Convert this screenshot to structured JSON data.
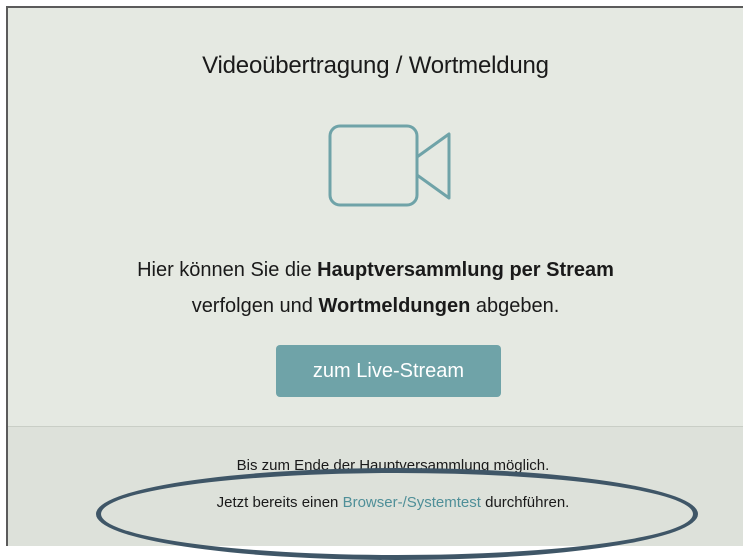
{
  "panel": {
    "title": "Videoübertragung / Wortmeldung",
    "icon": "video-camera-icon",
    "description": {
      "part1": "Hier können Sie die ",
      "bold1": "Hauptversammlung per Stream",
      "part2": "verfolgen und ",
      "bold2": "Wortmeldungen",
      "part3": " abgeben."
    },
    "button_label": "zum Live-Stream"
  },
  "footer": {
    "line1": "Bis zum Ende der Hauptversammlung möglich.",
    "line2_prefix": "Jetzt bereits einen ",
    "line2_link": "Browser-/Systemtest",
    "line2_suffix": " durchführen."
  },
  "colors": {
    "accent": "#6fa3a8",
    "link": "#4f8f98",
    "panel_bg": "#e5e9e2",
    "footer_bg": "#dde1da",
    "annotation_ellipse": "#3f5667"
  }
}
